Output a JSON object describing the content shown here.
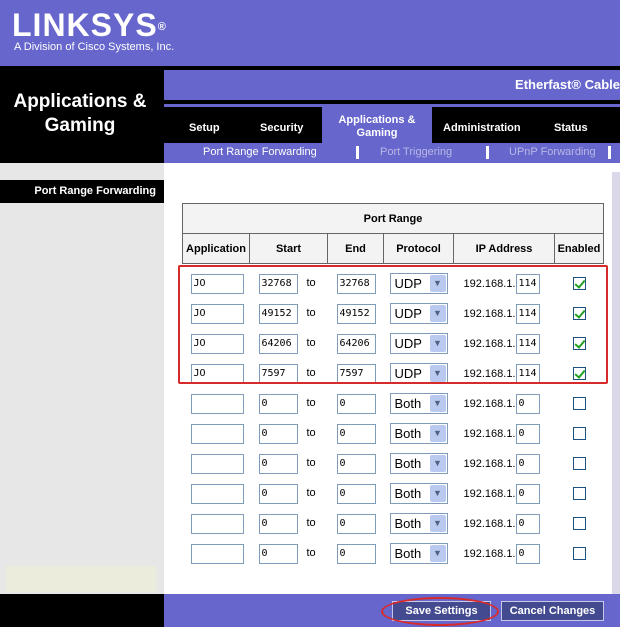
{
  "brand": {
    "name": "LINKSYS",
    "reg": "®",
    "tagline": "A Division of Cisco Systems, Inc."
  },
  "section_title": "Applications & Gaming",
  "product_name": "Etherfast® Cable",
  "tabs": [
    {
      "label": "Setup"
    },
    {
      "label": "Security"
    },
    {
      "label": "Applications & Gaming",
      "active": true
    },
    {
      "label": "Administration"
    },
    {
      "label": "Status"
    }
  ],
  "subtabs": [
    {
      "label": "Port Range Forwarding",
      "active": true
    },
    {
      "label": "Port Triggering"
    },
    {
      "label": "UPnP Forwarding"
    }
  ],
  "sidebar": {
    "label": "Port Range Forwarding"
  },
  "table": {
    "group_header": "Port Range",
    "headers": [
      "Application",
      "Start",
      "End",
      "Protocol",
      "IP Address",
      "Enabled"
    ],
    "to_label": "to",
    "ip_prefix": "192.168.1.",
    "rows": [
      {
        "application": "JO",
        "start": "32768",
        "end": "32768",
        "protocol": "UDP",
        "ip_last": "114",
        "enabled": true
      },
      {
        "application": "JO",
        "start": "49152",
        "end": "49152",
        "protocol": "UDP",
        "ip_last": "114",
        "enabled": true
      },
      {
        "application": "JO",
        "start": "64206",
        "end": "64206",
        "protocol": "UDP",
        "ip_last": "114",
        "enabled": true
      },
      {
        "application": "JO",
        "start": "7597",
        "end": "7597",
        "protocol": "UDP",
        "ip_last": "114",
        "enabled": true
      },
      {
        "application": "",
        "start": "0",
        "end": "0",
        "protocol": "Both",
        "ip_last": "0",
        "enabled": false
      },
      {
        "application": "",
        "start": "0",
        "end": "0",
        "protocol": "Both",
        "ip_last": "0",
        "enabled": false
      },
      {
        "application": "",
        "start": "0",
        "end": "0",
        "protocol": "Both",
        "ip_last": "0",
        "enabled": false
      },
      {
        "application": "",
        "start": "0",
        "end": "0",
        "protocol": "Both",
        "ip_last": "0",
        "enabled": false
      },
      {
        "application": "",
        "start": "0",
        "end": "0",
        "protocol": "Both",
        "ip_last": "0",
        "enabled": false
      },
      {
        "application": "",
        "start": "0",
        "end": "0",
        "protocol": "Both",
        "ip_last": "0",
        "enabled": false
      }
    ]
  },
  "buttons": {
    "save": "Save Settings",
    "cancel": "Cancel Changes"
  },
  "colors": {
    "brand_purple": "#6666cc",
    "button": "#434a8f",
    "highlight": "#d72a2a",
    "check": "#21a121"
  },
  "icons": [
    "dropdown-arrow-icon",
    "checkbox-icon"
  ]
}
